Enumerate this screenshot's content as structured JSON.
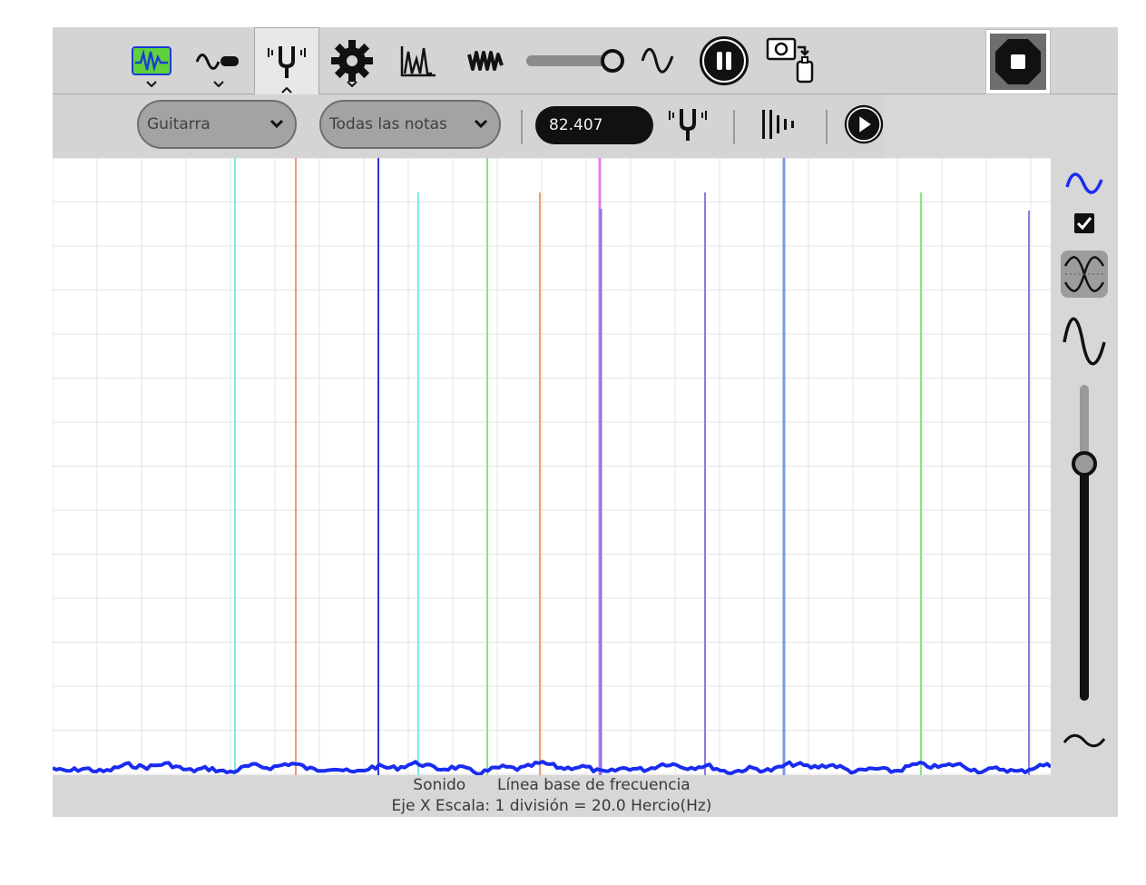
{
  "toolbar": {
    "icons": [
      "sound-wave-icon",
      "sensor-icon",
      "tuning-fork-icon",
      "gear-icon",
      "spectrum-icon",
      "waveform-icon",
      "sine-icon",
      "pause-icon",
      "camera-journal-icon",
      "stop-icon"
    ],
    "slider_value": 0.9
  },
  "subbar": {
    "instrument": "Guitarra",
    "notes": "Todas las notas",
    "frequency": "82.407"
  },
  "status": {
    "line1_left": "Sonido",
    "line1_right": "Línea base de frecuencia",
    "line2": "Eje X Escala: 1 división = 20.0 Hercio(Hz)"
  },
  "rightbar": {
    "checkbox_checked": true,
    "vertical_slider_value": 0.75
  },
  "colors": {
    "trace": "#1a2cf0",
    "grid": "#e3e3e3",
    "marker_cyan": "#7fe8e8",
    "marker_orange": "#f29a6f",
    "marker_blue": "#3333d6",
    "marker_green": "#86e67a",
    "marker_magenta": "#e67ae6",
    "marker_violet": "#8a7ae6"
  }
}
